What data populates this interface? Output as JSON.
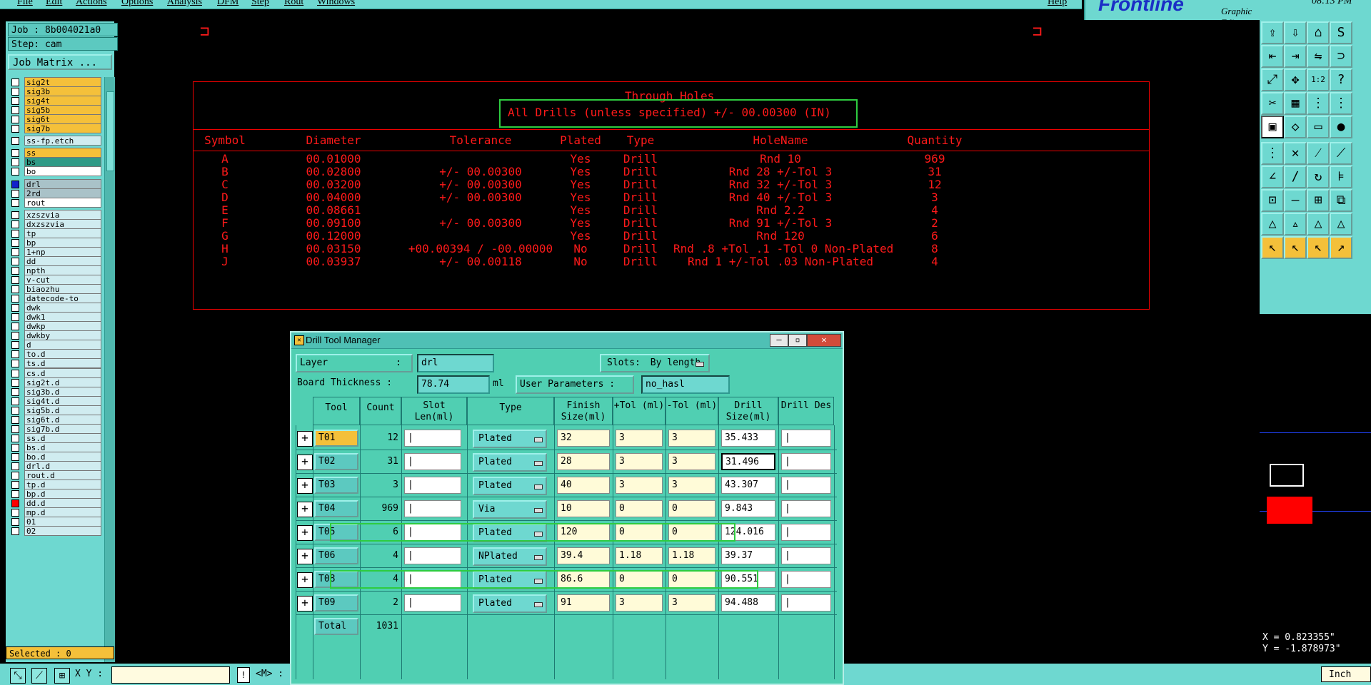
{
  "menu": [
    "File",
    "Edit",
    "Actions",
    "Options",
    "Analysis",
    "DFM",
    "Step",
    "Rout",
    "Windows"
  ],
  "help": "Help",
  "logo": {
    "brand": "Frontline",
    "subtitle": "Graphic Editor"
  },
  "clock": "08:13 PM",
  "job": {
    "job": "Job : 8b004021a0",
    "step": "Step: cam",
    "matrix_button": "Job Matrix ..."
  },
  "layers": [
    {
      "name": "sig2t",
      "color": "yellow",
      "mark": ""
    },
    {
      "name": "sig3b",
      "color": "yellow",
      "mark": ""
    },
    {
      "name": "sig4t",
      "color": "yellow",
      "mark": "◆"
    },
    {
      "name": "sig5b",
      "color": "yellow",
      "mark": "◆"
    },
    {
      "name": "sig6t",
      "color": "yellow",
      "mark": ""
    },
    {
      "name": "sig7b",
      "color": "yellow",
      "mark": "◆"
    },
    {
      "name": "ss-fp.etch",
      "color": "selected",
      "mark": ""
    },
    {
      "name": "ss",
      "color": "yellow",
      "mark": "◆"
    },
    {
      "name": "bs",
      "color": "teal",
      "mark": "◆"
    },
    {
      "name": "bo",
      "color": "white",
      "mark": ""
    },
    {
      "name": "drl",
      "color": "grey",
      "mark": "▫"
    },
    {
      "name": "2rd",
      "color": "grey",
      "mark": ""
    },
    {
      "name": "rout",
      "color": "white",
      "mark": ""
    },
    {
      "name": "xzszvia",
      "color": "selected",
      "mark": ""
    },
    {
      "name": "dxzszvia",
      "color": "selected",
      "mark": ""
    },
    {
      "name": "tp",
      "color": "selected",
      "mark": "◆"
    },
    {
      "name": "bp",
      "color": "selected",
      "mark": "◆"
    },
    {
      "name": "1+np",
      "color": "selected",
      "mark": ""
    },
    {
      "name": "dd",
      "color": "selected",
      "mark": ""
    },
    {
      "name": "npth",
      "color": "selected",
      "mark": ""
    },
    {
      "name": "v-cut",
      "color": "selected",
      "mark": ""
    },
    {
      "name": "biaozhu",
      "color": "selected",
      "mark": ""
    },
    {
      "name": "datecode-to",
      "color": "selected",
      "mark": ""
    },
    {
      "name": "dwk",
      "color": "selected",
      "mark": ""
    },
    {
      "name": "dwk1",
      "color": "selected",
      "mark": ""
    },
    {
      "name": "dwkp",
      "color": "selected",
      "mark": ""
    },
    {
      "name": "dwkby",
      "color": "selected",
      "mark": ""
    },
    {
      "name": "d",
      "color": "selected",
      "mark": ""
    },
    {
      "name": "to.d",
      "color": "selected",
      "mark": ""
    },
    {
      "name": "ts.d",
      "color": "selected",
      "mark": "◆"
    },
    {
      "name": "cs.d",
      "color": "selected",
      "mark": "◆"
    },
    {
      "name": "sig2t.d",
      "color": "selected",
      "mark": "◆"
    },
    {
      "name": "sig3b.d",
      "color": "selected",
      "mark": "◆"
    },
    {
      "name": "sig4t.d",
      "color": "selected",
      "mark": "◆"
    },
    {
      "name": "sig5b.d",
      "color": "selected",
      "mark": "◆"
    },
    {
      "name": "sig6t.d",
      "color": "selected",
      "mark": ""
    },
    {
      "name": "sig7b.d",
      "color": "selected",
      "mark": "◆"
    },
    {
      "name": "ss.d",
      "color": "selected",
      "mark": ""
    },
    {
      "name": "bs.d",
      "color": "selected",
      "mark": "◆"
    },
    {
      "name": "bo.d",
      "color": "selected",
      "mark": ""
    },
    {
      "name": "drl.d",
      "color": "selected",
      "mark": ""
    },
    {
      "name": "rout.d",
      "color": "selected",
      "mark": ""
    },
    {
      "name": "tp.d",
      "color": "selected",
      "mark": "◆"
    },
    {
      "name": "bp.d",
      "color": "selected",
      "mark": "◆"
    },
    {
      "name": "dd.d",
      "color": "selected",
      "mark": ""
    },
    {
      "name": "mp.d",
      "color": "selected",
      "mark": ""
    },
    {
      "name": "01",
      "color": "selected",
      "mark": ""
    },
    {
      "name": "02",
      "color": "selected",
      "mark": ""
    }
  ],
  "selected": "Selected : 0",
  "bottom": {
    "xy_label": "X Y :",
    "m_label": "<M> :",
    "units": "Inch"
  },
  "drawing": {
    "title": "Through Holes",
    "subtitle": "All Drills (unless specified) +/- 00.00300 (IN)",
    "headers": [
      "Symbol",
      "Diameter",
      "Tolerance",
      "Plated",
      "Type",
      "HoleName",
      "Quantity"
    ],
    "rows": [
      [
        "A",
        "00.01000",
        "",
        "Yes",
        "Drill",
        "Rnd 10",
        "969"
      ],
      [
        "B",
        "00.02800",
        "+/- 00.00300",
        "Yes",
        "Drill",
        "Rnd 28 +/-Tol 3",
        "31"
      ],
      [
        "C",
        "00.03200",
        "+/- 00.00300",
        "Yes",
        "Drill",
        "Rnd 32 +/-Tol 3",
        "12"
      ],
      [
        "D",
        "00.04000",
        "+/- 00.00300",
        "Yes",
        "Drill",
        "Rnd 40 +/-Tol 3",
        "3"
      ],
      [
        "E",
        "00.08661",
        "",
        "Yes",
        "Drill",
        "Rnd 2.2",
        "4"
      ],
      [
        "F",
        "00.09100",
        "+/- 00.00300",
        "Yes",
        "Drill",
        "Rnd 91 +/-Tol 3",
        "2"
      ],
      [
        "G",
        "00.12000",
        "",
        "Yes",
        "Drill",
        "Rnd 120",
        "6"
      ],
      [
        "H",
        "00.03150",
        "+00.00394 / -00.00000",
        "No",
        "Drill",
        "Rnd .8 +Tol .1 -Tol 0 Non-Plated",
        "8"
      ],
      [
        "J",
        "00.03937",
        "+/- 00.00118",
        "No",
        "Drill",
        "Rnd 1 +/-Tol .03 Non-Plated",
        "4"
      ]
    ]
  },
  "coords": {
    "x": "X = 0.823355\"",
    "y": "Y = -1.878973\""
  },
  "dialog": {
    "title": "Drill Tool Manager",
    "layer_label": "Layer",
    "layer_colon": ":",
    "layer_value": "drl",
    "slots_label": "Slots:",
    "slots_value": "By length",
    "thickness_label": "Board Thickness :",
    "thickness_value": "78.74",
    "thickness_unit": "ml",
    "user_params_label": "User Parameters :",
    "user_params_value": "no_hasl",
    "columns": [
      "Tool",
      "Count",
      "Slot Len(ml)",
      "Type",
      "Finish Size(ml)",
      "+Tol (ml)",
      "-Tol (ml)",
      "Drill Size(ml)",
      "Drill Des"
    ],
    "rows": [
      {
        "tool": "T01",
        "count": "12",
        "type": "Plated",
        "finish": "32",
        "ptol": "3",
        "mtol": "3",
        "drill": "35.433"
      },
      {
        "tool": "T02",
        "count": "31",
        "type": "Plated",
        "finish": "28",
        "ptol": "3",
        "mtol": "3",
        "drill": "31.496"
      },
      {
        "tool": "T03",
        "count": "3",
        "type": "Plated",
        "finish": "40",
        "ptol": "3",
        "mtol": "3",
        "drill": "43.307"
      },
      {
        "tool": "T04",
        "count": "969",
        "type": "Via",
        "finish": "10",
        "ptol": "0",
        "mtol": "0",
        "drill": "9.843"
      },
      {
        "tool": "T05",
        "count": "6",
        "type": "Plated",
        "finish": "120",
        "ptol": "0",
        "mtol": "0",
        "drill": "124.016"
      },
      {
        "tool": "T06",
        "count": "4",
        "type": "NPlated",
        "finish": "39.4",
        "ptol": "1.18",
        "mtol": "1.18",
        "drill": "39.37"
      },
      {
        "tool": "T08",
        "count": "4",
        "type": "Plated",
        "finish": "86.6",
        "ptol": "0",
        "mtol": "0",
        "drill": "90.551"
      },
      {
        "tool": "T09",
        "count": "2",
        "type": "Plated",
        "finish": "91",
        "ptol": "3",
        "mtol": "3",
        "drill": "94.488"
      }
    ],
    "total_label": "Total",
    "total_value": "1031"
  }
}
